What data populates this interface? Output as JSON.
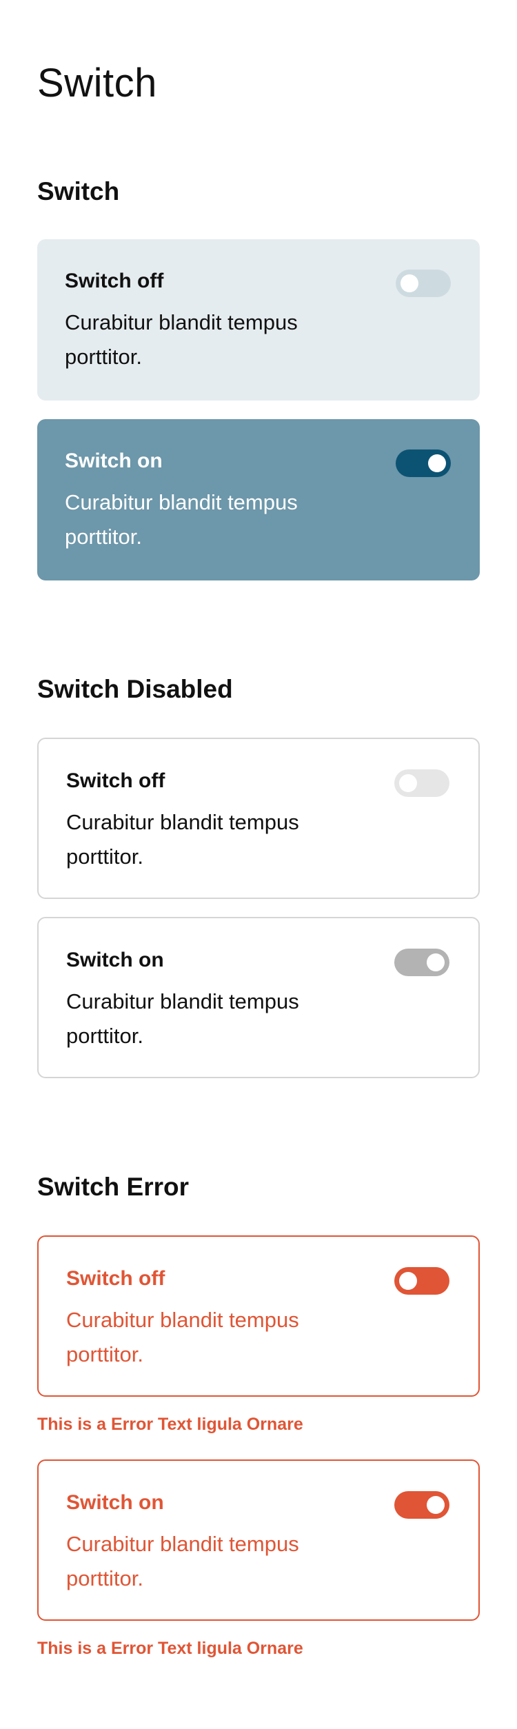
{
  "page_title": "Switch",
  "sections": [
    {
      "title": "Switch",
      "items": [
        {
          "title": "Switch off",
          "description": "Curabitur blandit tempus porttitor.",
          "checked": false
        },
        {
          "title": "Switch on",
          "description": "Curabitur blandit tempus porttitor.",
          "checked": true
        }
      ]
    },
    {
      "title": "Switch Disabled",
      "items": [
        {
          "title": "Switch off",
          "description": "Curabitur blandit tempus porttitor.",
          "checked": false
        },
        {
          "title": "Switch on",
          "description": "Curabitur blandit tempus porttitor.",
          "checked": true
        }
      ]
    },
    {
      "title": "Switch Error",
      "items": [
        {
          "title": "Switch off",
          "description": "Curabitur blandit tempus porttitor.",
          "checked": false,
          "error_text": "This is a Error Text ligula Ornare"
        },
        {
          "title": "Switch on",
          "description": "Curabitur blandit tempus porttitor.",
          "checked": true,
          "error_text": "This is a Error Text ligula Ornare"
        }
      ]
    }
  ],
  "colors": {
    "accent": "#0c5373",
    "card_on_bg": "#6d97aa",
    "card_off_bg": "#e5ecef",
    "error": "#e05535",
    "disabled_track": "#b3b3b3"
  }
}
